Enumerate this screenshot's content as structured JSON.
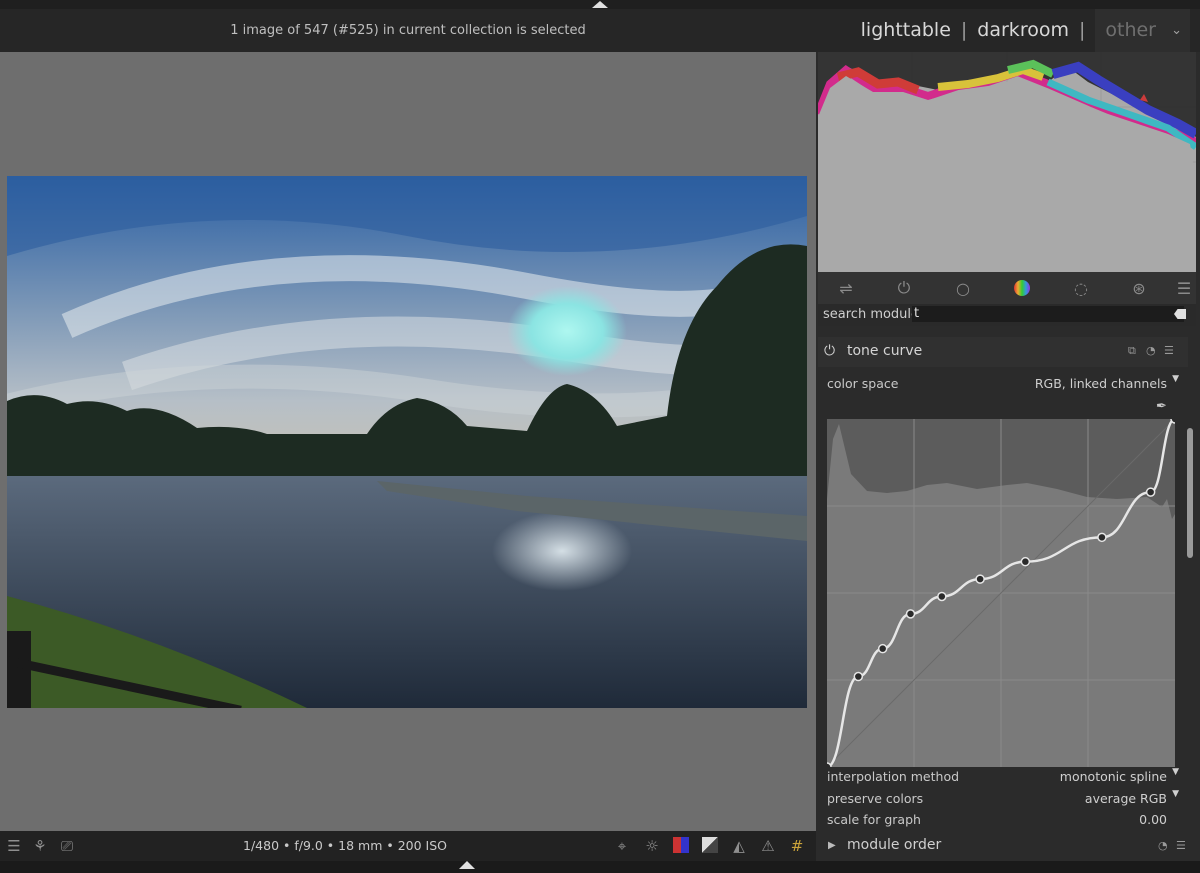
{
  "header": {
    "status": "1 image of 547 (#525) in current collection is selected",
    "views": {
      "lighttable": "lighttable",
      "darkroom": "darkroom",
      "other": "other",
      "sep": "|"
    }
  },
  "search": {
    "label": "search module",
    "value": "t"
  },
  "tone_curve": {
    "title": "tone curve",
    "color_space_label": "color space",
    "color_space_value": "RGB, linked channels",
    "interpolation_label": "interpolation method",
    "interpolation_value": "monotonic spline",
    "preserve_label": "preserve colors",
    "preserve_value": "average RGB",
    "scale_label": "scale for graph",
    "scale_value": "0.00",
    "points": [
      [
        0,
        0
      ],
      [
        0.09,
        0.26
      ],
      [
        0.16,
        0.34
      ],
      [
        0.24,
        0.44
      ],
      [
        0.33,
        0.49
      ],
      [
        0.44,
        0.54
      ],
      [
        0.57,
        0.59
      ],
      [
        0.79,
        0.66
      ],
      [
        0.93,
        0.79
      ],
      [
        1,
        1
      ]
    ]
  },
  "bottom": {
    "exif": "1/480 • f/9.0 • 18 mm • 200 ISO"
  },
  "module_order": {
    "title": "module order"
  },
  "colors": {
    "panel": "#2b2b2b",
    "center": "#6e6e6e",
    "histogram": "#a9a9a9"
  }
}
